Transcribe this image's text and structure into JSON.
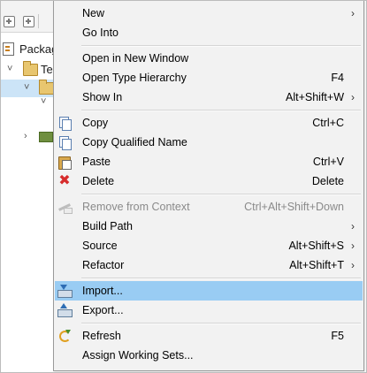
{
  "background": {
    "view_tab_label": "Package",
    "tree": [
      {
        "label": "Te",
        "twisty": "˅"
      },
      {
        "label": "",
        "twisty": "˅"
      },
      {
        "label": "",
        "twisty": "˅"
      },
      {
        "label": "",
        "twisty": "›"
      }
    ]
  },
  "menu": {
    "highlight_color": "#99ccf3",
    "items": {
      "new": {
        "label": "New",
        "shortcut": "",
        "arrow": "›"
      },
      "go_into": {
        "label": "Go Into",
        "shortcut": ""
      },
      "open_new_window": {
        "label": "Open in New Window",
        "shortcut": ""
      },
      "open_type_hierarchy": {
        "label": "Open Type Hierarchy",
        "shortcut": "F4"
      },
      "show_in": {
        "label": "Show In",
        "shortcut": "Alt+Shift+W",
        "arrow": "›"
      },
      "copy": {
        "label": "Copy",
        "shortcut": "Ctrl+C",
        "icon": "copy-icon"
      },
      "copy_qualified": {
        "label": "Copy Qualified Name",
        "shortcut": "",
        "icon": "copy-qualified-name-icon"
      },
      "paste": {
        "label": "Paste",
        "shortcut": "Ctrl+V",
        "icon": "paste-icon"
      },
      "delete": {
        "label": "Delete",
        "shortcut": "Delete",
        "icon": "delete-icon",
        "icon_glyph": "✖"
      },
      "remove_from_context": {
        "label": "Remove from Context",
        "shortcut": "Ctrl+Alt+Shift+Down",
        "icon": "remove-from-context-icon",
        "disabled": true
      },
      "build_path": {
        "label": "Build Path",
        "shortcut": "",
        "arrow": "›"
      },
      "source": {
        "label": "Source",
        "shortcut": "Alt+Shift+S",
        "arrow": "›"
      },
      "refactor": {
        "label": "Refactor",
        "shortcut": "Alt+Shift+T",
        "arrow": "›"
      },
      "import": {
        "label": "Import...",
        "shortcut": "",
        "icon": "import-icon",
        "highlighted": true
      },
      "export": {
        "label": "Export...",
        "shortcut": "",
        "icon": "export-icon"
      },
      "refresh": {
        "label": "Refresh",
        "shortcut": "F5",
        "icon": "refresh-icon"
      },
      "assign_working_sets": {
        "label": "Assign Working Sets...",
        "shortcut": ""
      }
    }
  }
}
